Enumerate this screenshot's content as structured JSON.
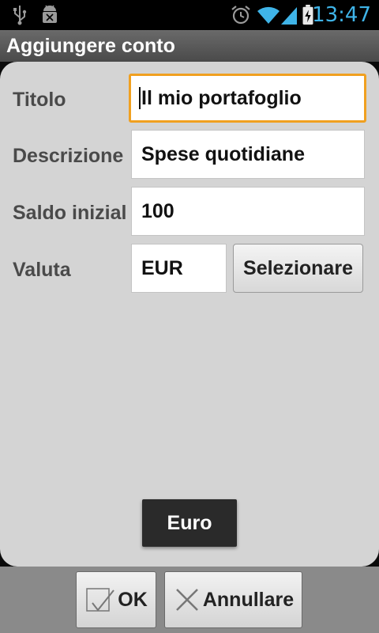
{
  "status_bar": {
    "time": "13:47",
    "icons": [
      "usb-icon",
      "android-debug-icon",
      "alarm-icon",
      "wifi-icon",
      "signal-icon",
      "battery-charging-icon"
    ]
  },
  "title_bar": {
    "title": "Aggiungere conto"
  },
  "form": {
    "title_label": "Titolo",
    "title_value": "Il mio portafoglio",
    "description_label": "Descrizione",
    "description_value": "Spese quotidiane",
    "balance_label": "Saldo inizial",
    "balance_value": "100",
    "currency_label": "Valuta",
    "currency_value": "EUR",
    "select_button": "Selezionare"
  },
  "toast": {
    "text": "Euro"
  },
  "bottom_bar": {
    "ok_label": "OK",
    "cancel_label": "Annullare"
  },
  "colors": {
    "focus": "#f0a020",
    "clock": "#3fb4e8"
  }
}
